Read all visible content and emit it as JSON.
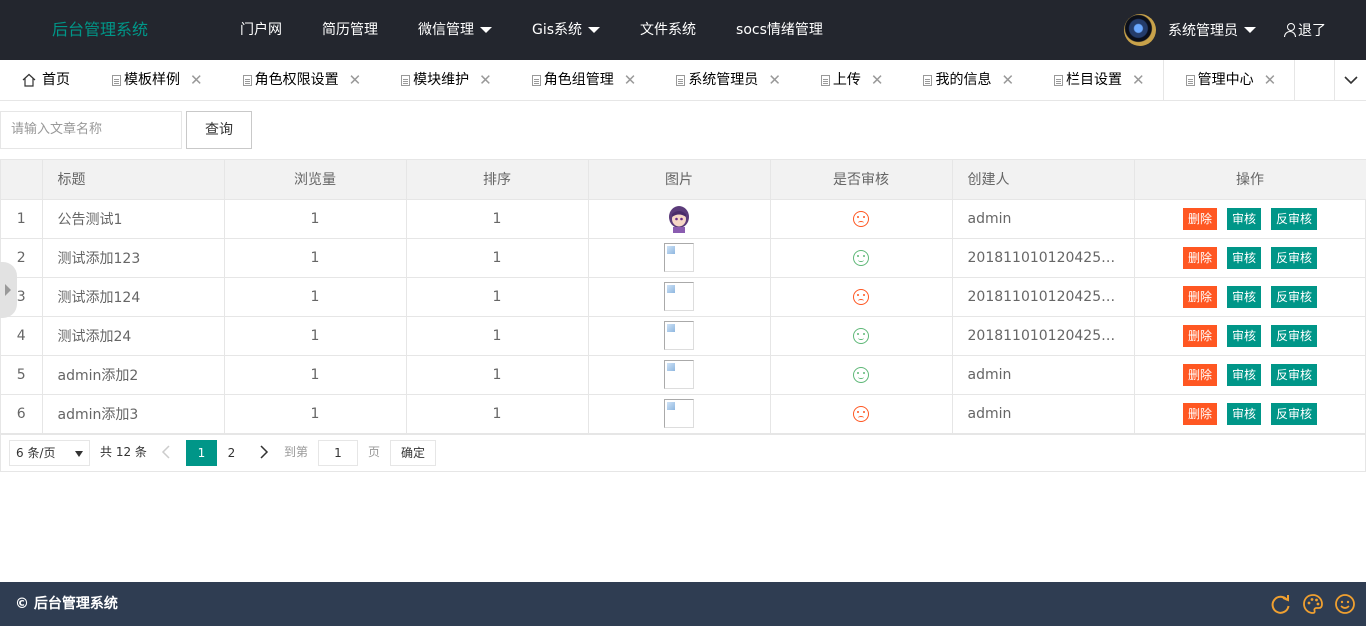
{
  "header": {
    "logo": "后台管理系统",
    "nav": [
      {
        "label": "门户网",
        "dropdown": false
      },
      {
        "label": "简历管理",
        "dropdown": false
      },
      {
        "label": "微信管理",
        "dropdown": true
      },
      {
        "label": "Gis系统",
        "dropdown": true
      },
      {
        "label": "文件系统",
        "dropdown": false
      },
      {
        "label": "socs情绪管理",
        "dropdown": false
      }
    ],
    "user_name": "系统管理员",
    "logout": "退了"
  },
  "tabs": [
    {
      "label": "首页",
      "icon": "home-icon",
      "closable": false
    },
    {
      "label": "模板样例",
      "icon": "doc-icon",
      "closable": true
    },
    {
      "label": "角色权限设置",
      "icon": "doc-icon",
      "closable": true
    },
    {
      "label": "模块维护",
      "icon": "doc-icon",
      "closable": true
    },
    {
      "label": "角色组管理",
      "icon": "doc-icon",
      "closable": true
    },
    {
      "label": "系统管理员",
      "icon": "doc-icon",
      "closable": true
    },
    {
      "label": "上传",
      "icon": "doc-icon",
      "closable": true
    },
    {
      "label": "我的信息",
      "icon": "doc-icon",
      "closable": true
    },
    {
      "label": "栏目设置",
      "icon": "doc-icon",
      "closable": true
    },
    {
      "label": "管理中心",
      "icon": "doc-icon",
      "closable": true,
      "active": true
    }
  ],
  "search": {
    "placeholder": "请输入文章名称",
    "button": "查询"
  },
  "table": {
    "columns": [
      "",
      "标题",
      "浏览量",
      "排序",
      "图片",
      "是否审核",
      "创建人",
      "操作"
    ],
    "rows": [
      {
        "no": "1",
        "title": "公告测试1",
        "views": "1",
        "order": "1",
        "image": "avatar",
        "audited": "sad",
        "creator": "admin"
      },
      {
        "no": "2",
        "title": "测试添加123",
        "views": "1",
        "order": "1",
        "image": "broken",
        "audited": "happy",
        "creator": "20181101012042525..."
      },
      {
        "no": "3",
        "title": "测试添加124",
        "views": "1",
        "order": "1",
        "image": "broken",
        "audited": "sad",
        "creator": "20181101012042525..."
      },
      {
        "no": "4",
        "title": "测试添加24",
        "views": "1",
        "order": "1",
        "image": "broken",
        "audited": "happy",
        "creator": "20181101012042525..."
      },
      {
        "no": "5",
        "title": "admin添加2",
        "views": "1",
        "order": "1",
        "image": "broken",
        "audited": "happy",
        "creator": "admin"
      },
      {
        "no": "6",
        "title": "admin添加3",
        "views": "1",
        "order": "1",
        "image": "broken",
        "audited": "sad",
        "creator": "admin"
      }
    ],
    "actions": {
      "delete": "删除",
      "audit": "审核",
      "unaudit": "反审核"
    }
  },
  "pager": {
    "page_size": "6 条/页",
    "total": "共 12 条",
    "pages": [
      "1",
      "2"
    ],
    "current": "1",
    "goto_label": "到第",
    "goto_value": "1",
    "page_label": "页",
    "confirm": "确定"
  },
  "footer": {
    "text": "© 后台管理系统"
  },
  "colors": {
    "header_bg": "#23262e",
    "accent": "#009688",
    "danger": "#ff5722",
    "footer_bg": "#2f3d52"
  }
}
